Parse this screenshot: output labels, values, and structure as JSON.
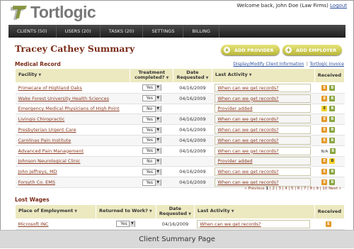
{
  "app": {
    "logo_text": "Tortlogic",
    "welcome_text": "Welcome back, John Doe (Law Firms)",
    "logout_label": "Logout"
  },
  "nav": {
    "items": [
      "CLIENTS (50)",
      "USERS (20)",
      "TASKS (20)",
      "SETTINGS",
      "BILLING"
    ]
  },
  "page": {
    "title": "Tracey Cathey Summary",
    "add_provider_label": "ADD PROVIDER",
    "add_employer_label": "ADD EMPLOYER"
  },
  "medical": {
    "section_title": "Medical Record",
    "link_info": "Display/Modify Client Information",
    "link_invoice": "Tortlogic Invoice",
    "headers": {
      "facility": "Facility",
      "treatment": "Treatment completed?",
      "date": "Date Requested",
      "activity": "Last Activity",
      "received": "Received"
    },
    "rows": [
      {
        "facility": "Primecare of Highland Oaks",
        "treatment": "Yes",
        "date": "04/16/2009",
        "activity": "When can we get records?",
        "received": [
          "E",
          "B"
        ]
      },
      {
        "facility": "Wake Forest University Health Sciences",
        "treatment": "Yes",
        "date": "04/16/2009",
        "activity": "When can we get records?",
        "received": [
          "E",
          "B"
        ]
      },
      {
        "facility": "Emergency Medical Physicians of High Point",
        "treatment": "No",
        "date": "",
        "activity": "Provider added",
        "received": [
          "E?",
          "B"
        ]
      },
      {
        "facility": "Livingis Chiropractic",
        "treatment": "Yes",
        "date": "04/16/2009",
        "activity": "When can we get records?",
        "received": [
          "E",
          "B"
        ]
      },
      {
        "facility": "Presbyterian Urgent Care",
        "treatment": "Yes",
        "date": "04/16/2009",
        "activity": "When can we get records?",
        "received": [
          "E",
          "B"
        ]
      },
      {
        "facility": "Carolinas Pain Institute",
        "treatment": "Yes",
        "date": "04/16/2009",
        "activity": "When can we get records?",
        "received": [
          "E",
          "B"
        ]
      },
      {
        "facility": "Advanced Pain Management",
        "treatment": "Yes",
        "date": "04/16/2009",
        "activity": "When can we get records?",
        "received": [
          "N/A",
          "B"
        ]
      },
      {
        "facility": "Johnson Neurological Clinic",
        "treatment": "No",
        "date": "",
        "activity": "Provider added",
        "received": [
          "E",
          "B?"
        ]
      },
      {
        "facility": "John Jeffreys, MD",
        "treatment": "Yes",
        "date": "04/16/2009",
        "activity": "When can we get records?",
        "received": [
          "E",
          "B"
        ]
      },
      {
        "facility": "Forsyth Co. EMS",
        "treatment": "Yes",
        "date": "04/16/2009",
        "activity": "When can we get records?",
        "received": [
          "E",
          "B"
        ]
      }
    ],
    "pager": {
      "prev": "« Previous",
      "current": "1",
      "pages": "| 2 | 3 | 4 | 5 | 6 | 7 | 8 | 9 | 10",
      "next": "Next »"
    }
  },
  "wages": {
    "section_title": "Lost Wages",
    "headers": {
      "employer": "Place of Employment",
      "returned": "Returned to Work?",
      "date": "Date Requested",
      "activity": "Last Activity",
      "received": "Received"
    },
    "rows": [
      {
        "employer": "Microsoft INC",
        "returned": "Yes",
        "date": "04/16/2009",
        "activity": "When can we get records?",
        "received": [
          "E"
        ]
      }
    ]
  },
  "footer": {
    "caption": "Client Summary Page"
  },
  "colors": {
    "title": "#7a2b18",
    "header_bg": "#ece9c0",
    "button": "#b9b63a",
    "nav": "#1e1e1e"
  }
}
